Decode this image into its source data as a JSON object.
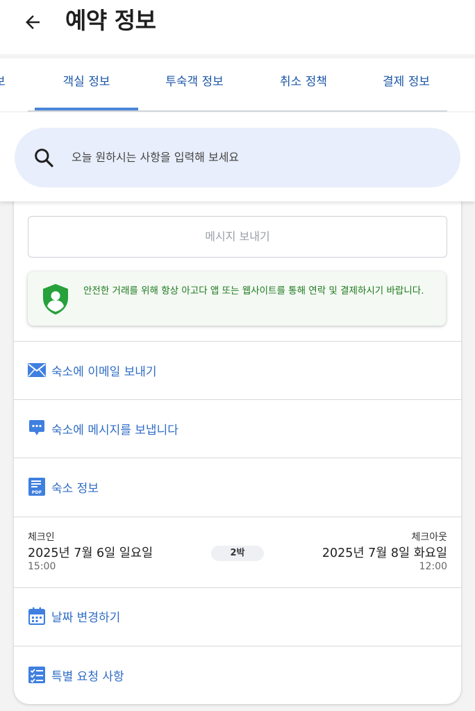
{
  "header": {
    "title": "예약 정보"
  },
  "tabs": [
    {
      "label": "보"
    },
    {
      "label": "객실 정보"
    },
    {
      "label": "투숙객 정보"
    },
    {
      "label": "취소 정책"
    },
    {
      "label": "결제 정보"
    }
  ],
  "search": {
    "placeholder": "오늘 원하시는 사항을 입력해 보세요"
  },
  "message_button": {
    "label": "메시지 보내기"
  },
  "notice": {
    "text": "안전한 거래를 위해 항상 아고다 앱 또는 웹사이트를 통해 연락 및 결제하시기 바랍니다."
  },
  "links": {
    "email": "숙소에 이메일 보내기",
    "message": "숙소에 메시지를 보냅니다",
    "property_info": "숙소 정보"
  },
  "stay": {
    "checkin_label": "체크인",
    "checkin_date": "2025년 7월 6일 일요일",
    "checkin_time": "15:00",
    "nights": "2박",
    "checkout_label": "체크아웃",
    "checkout_date": "2025년 7월 8일 화요일",
    "checkout_time": "12:00"
  },
  "actions": {
    "change_dates": "날짜 변경하기",
    "special_requests": "특별 요청 사항"
  },
  "icons": {
    "pdf_badge": "PDF"
  },
  "colors": {
    "link_blue": "#2f6cc5",
    "tab_blue": "#1a56a8",
    "active_tab_bar": "#4a86d8",
    "search_bg": "#e8eefb",
    "notice_green": "#1e7a1e",
    "shield_green": "#27a13b"
  }
}
